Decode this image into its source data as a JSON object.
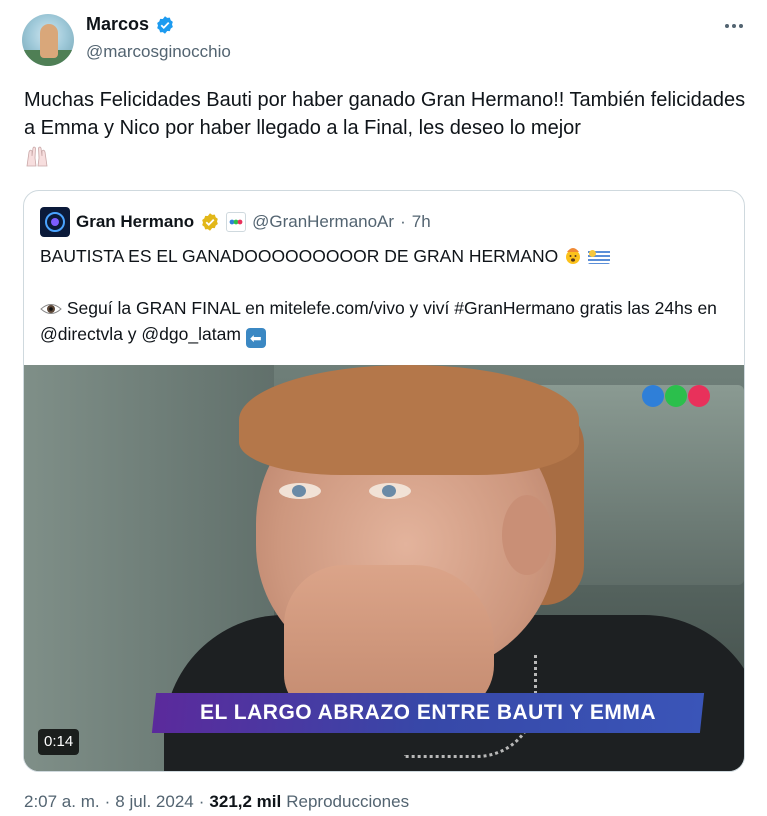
{
  "author": {
    "name": "Marcos",
    "handle": "@marcosginocchio"
  },
  "tweet": {
    "text": "Muchas Felicidades Bauti por haber ganado Gran Hermano!! También felicidades a Emma y Nico por haber llegado a la Final, les deseo lo mejor"
  },
  "quoted": {
    "name": "Gran Hermano",
    "handle": "@GranHermanoAr",
    "separator": "·",
    "time": "7h",
    "line1": "BAUTISTA ES EL GANADOOOOOOOOOR DE GRAN HERMANO",
    "line2": "Seguí la GRAN FINAL en mitelefe.com/vivo y viví #GranHermano gratis las 24hs en @directvla y @dgo_latam",
    "video": {
      "caption": "EL LARGO ABRAZO ENTRE BAUTI Y EMMA",
      "duration": "0:14"
    }
  },
  "footer": {
    "time": "2:07 a. m.",
    "dot": "·",
    "date": "8 jul. 2024",
    "dot2": "·",
    "views_count": "321,2 mil",
    "views_label": "Reproducciones"
  },
  "colors": {
    "verified_blue": "#1d9bf0",
    "verified_gold": "#e2b719",
    "secondary_text": "#536471",
    "logo_blue": "#2f7fd8",
    "logo_green": "#2bbf4c",
    "logo_red": "#e8315b"
  },
  "icons": [
    "verified-icon",
    "gold-verified-icon",
    "more-icon",
    "raised-hands-icon",
    "eye-icon",
    "exploding-head-icon",
    "uruguay-flag-icon",
    "back-arrow-icon"
  ]
}
